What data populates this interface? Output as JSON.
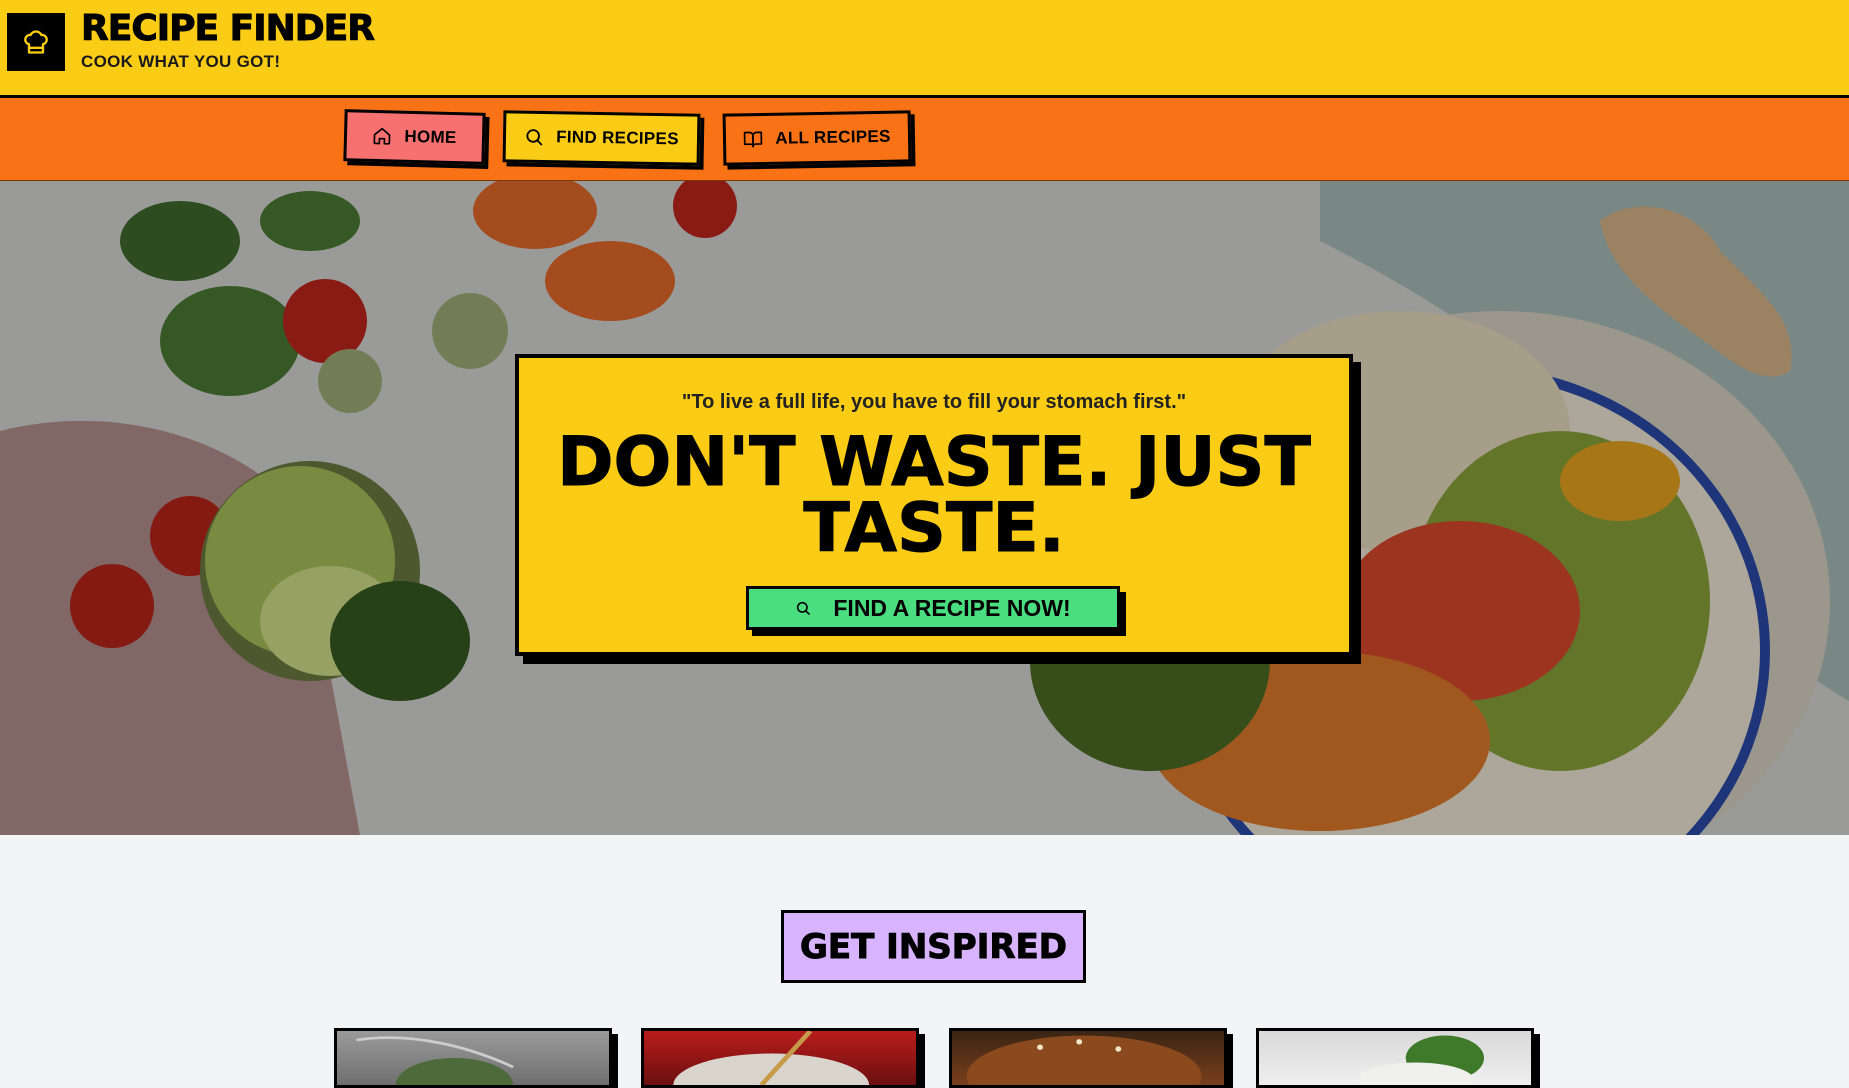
{
  "header": {
    "title": "RECIPE FINDER",
    "tagline": "COOK WHAT YOU GOT!",
    "logo_icon": "chef-hat-icon"
  },
  "nav": {
    "items": [
      {
        "label": "HOME",
        "icon": "home-icon",
        "color": "#f87171"
      },
      {
        "label": "FIND RECIPES",
        "icon": "search-icon",
        "color": "#facc15"
      },
      {
        "label": "ALL RECIPES",
        "icon": "book-icon",
        "color": "#f97316"
      }
    ]
  },
  "hero": {
    "quote": "\"To live a full life, you have to fill your stomach first.\"",
    "heading": "DON'T WASTE. JUST TASTE.",
    "cta_label": "FIND A RECIPE NOW!",
    "cta_icon": "search-icon"
  },
  "inspired": {
    "title": "GET INSPIRED"
  },
  "colors": {
    "header_bg": "#facc15",
    "nav_bg": "#f97316",
    "cta_bg": "#4ade80",
    "badge_bg": "#d8b4fe",
    "page_bg": "#f3f4f6"
  }
}
